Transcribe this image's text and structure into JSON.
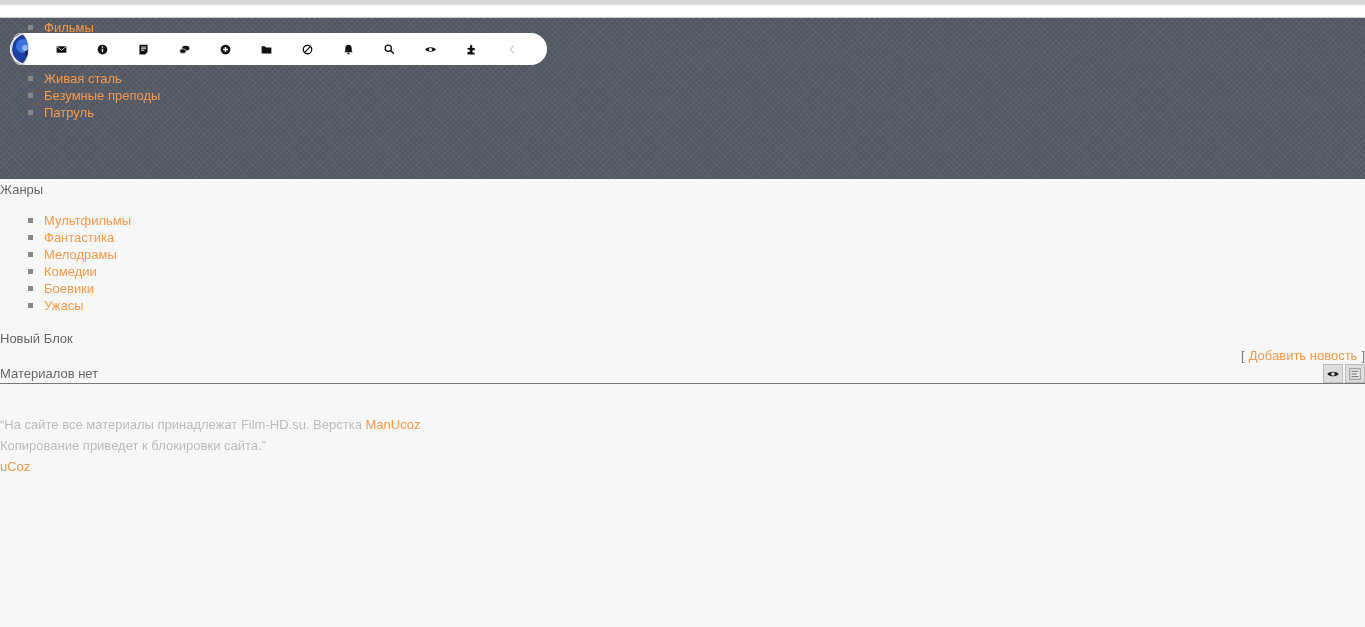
{
  "header_menu": [
    {
      "label": "Фильмы"
    },
    {
      "label": "Живая сталь"
    },
    {
      "label": "Безумные преподы"
    },
    {
      "label": "Патруль"
    }
  ],
  "genres": {
    "title": "Жанры",
    "items": [
      "Мультфильмы",
      "Фантастика",
      "Мелодрамы",
      "Комедии",
      "Боевики",
      "Ужасы"
    ]
  },
  "block": {
    "title": "Новый Блок",
    "bracket_open": "[",
    "add_link": "Добавить новость",
    "bracket_close": "]",
    "empty_text": "Материалов нет"
  },
  "footer": {
    "line_1": "“На сайте все материалы принадлежат Film-HD.su. Верстка",
    "line_1_link": "ManUcoz",
    "line_2": "Копирование приведет к блокировки сайта.”",
    "ucoz_link": "uCoz"
  }
}
